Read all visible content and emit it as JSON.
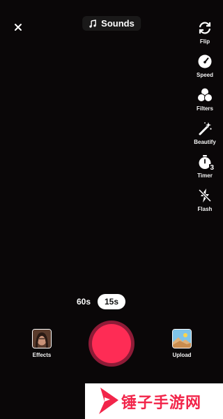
{
  "top_bar": {
    "sounds_label": "Sounds"
  },
  "side_tools": [
    {
      "label": "Flip",
      "icon": "flip-icon"
    },
    {
      "label": "Speed",
      "icon": "speed-icon"
    },
    {
      "label": "Filters",
      "icon": "filters-icon"
    },
    {
      "label": "Beautify",
      "icon": "beautify-icon"
    },
    {
      "label": "Timer",
      "icon": "timer-icon",
      "badge": "3"
    },
    {
      "label": "Flash",
      "icon": "flash-off-icon"
    }
  ],
  "durations": {
    "long": "60s",
    "short": "15s",
    "selected": "15s"
  },
  "bottom": {
    "effects_label": "Effects",
    "upload_label": "Upload"
  },
  "watermark": {
    "text": "锤子手游网"
  },
  "colors": {
    "record": "#fe2c55",
    "record_ring": "#8e1b37",
    "background": "#0a0708",
    "watermark": "#f2254a"
  }
}
